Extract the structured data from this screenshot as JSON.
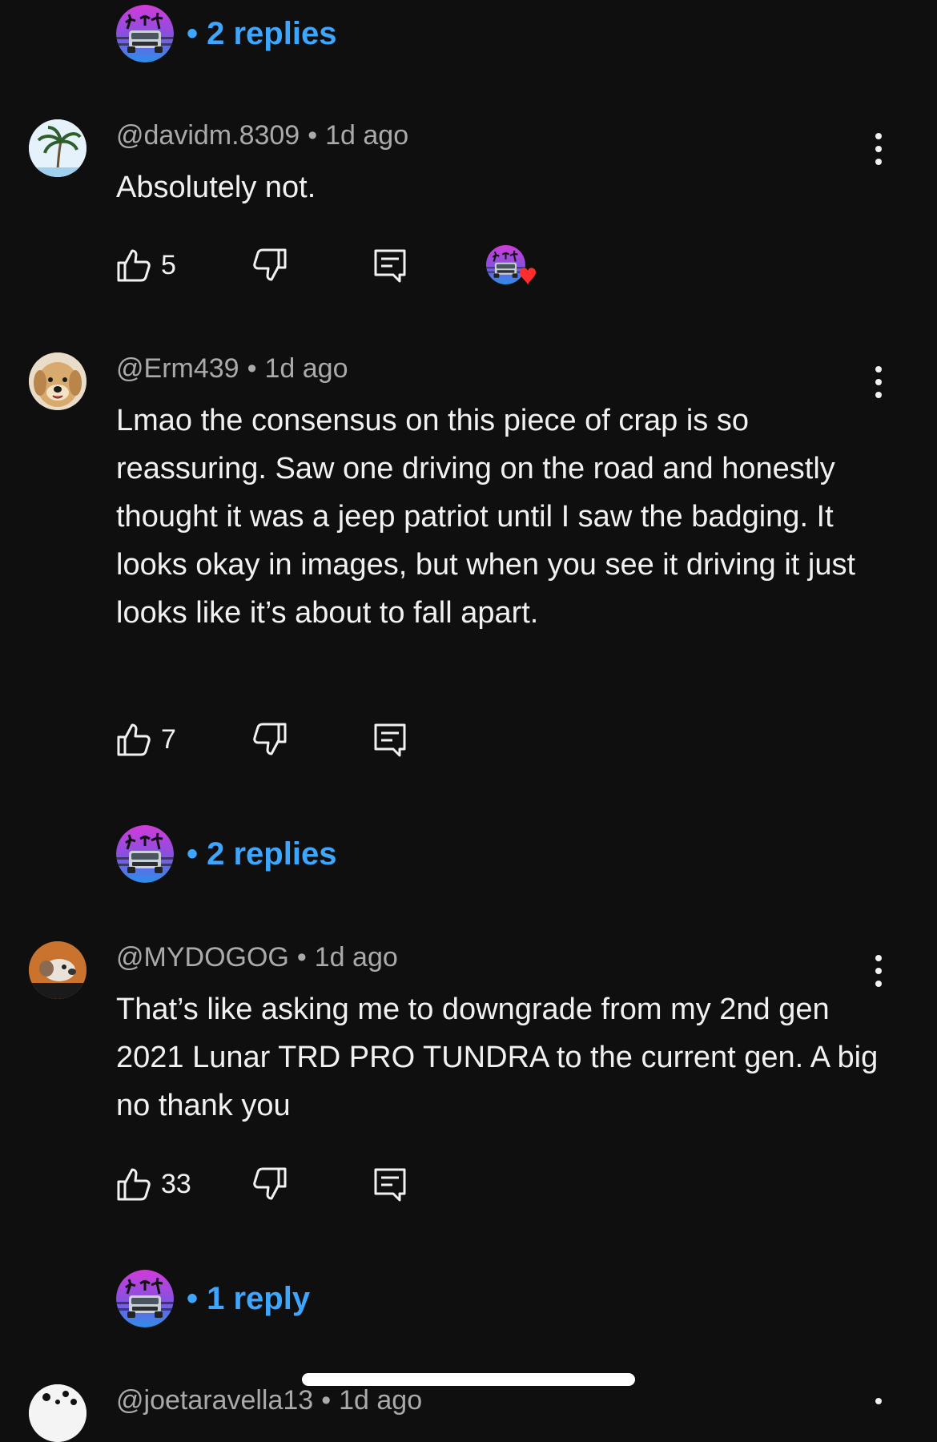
{
  "replies_block_1": {
    "label": "• 2 replies"
  },
  "comments": [
    {
      "handle": "@davidm.8309",
      "time": "1d ago",
      "text": "Absolutely not.",
      "likes": "5",
      "creator_hearted": true
    },
    {
      "handle": "@Erm439",
      "time": "1d ago",
      "text": "Lmao the consensus on this piece of crap is so reassuring. Saw one driving on the road and honestly thought it was a jeep patriot until I saw the badging. It looks okay in images, but when you see it driving it just looks like it’s about to fall apart.",
      "likes": "7",
      "replies_label": "• 2 replies"
    },
    {
      "handle": "@MYDOGOG",
      "time": "1d ago",
      "text": "That’s like asking me to downgrade from my 2nd gen 2021 Lunar TRD PRO TUNDRA to the current gen. A big no thank you",
      "likes": "33",
      "replies_label": "• 1 reply"
    },
    {
      "handle": "@joetaravella13",
      "time": "1d ago"
    }
  ],
  "separator": "•",
  "colors": {
    "background": "#0f0f0f",
    "link": "#3ea6ff",
    "meta": "#aaaaaa",
    "heart": "#ff2d2d"
  }
}
